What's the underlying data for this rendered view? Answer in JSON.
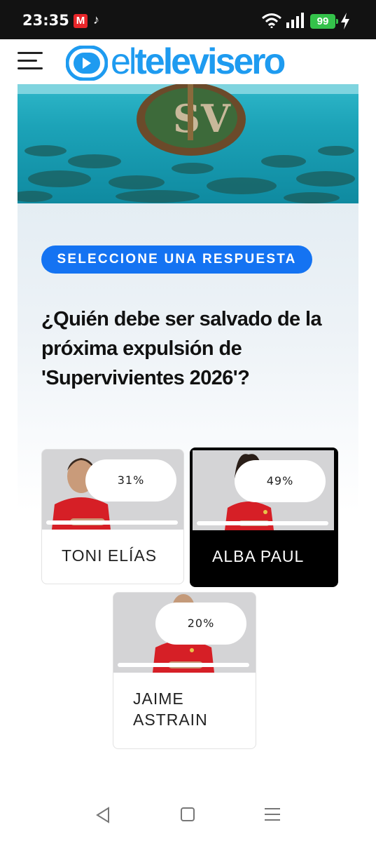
{
  "status_bar": {
    "time": "23:35",
    "notification_m": "M",
    "battery": "99"
  },
  "header": {
    "logo_prefix": "el",
    "logo_main": "televisero",
    "brand_color": "#1e9bf0"
  },
  "poll": {
    "badge": "SELECCIONE UNA RESPUESTA",
    "question": "¿Quién debe ser salvado de la próxima expulsión de 'Supervivientes 2026'?",
    "options": [
      {
        "name": "TONI ELÍAS",
        "percent": "31%",
        "value": 31,
        "selected": false
      },
      {
        "name": "ALBA PAUL",
        "percent": "49%",
        "value": 49,
        "selected": true
      },
      {
        "name": "JAIME ASTRAIN",
        "percent": "20%",
        "value": 20,
        "selected": false
      }
    ],
    "badge_color": "#1473f2"
  }
}
